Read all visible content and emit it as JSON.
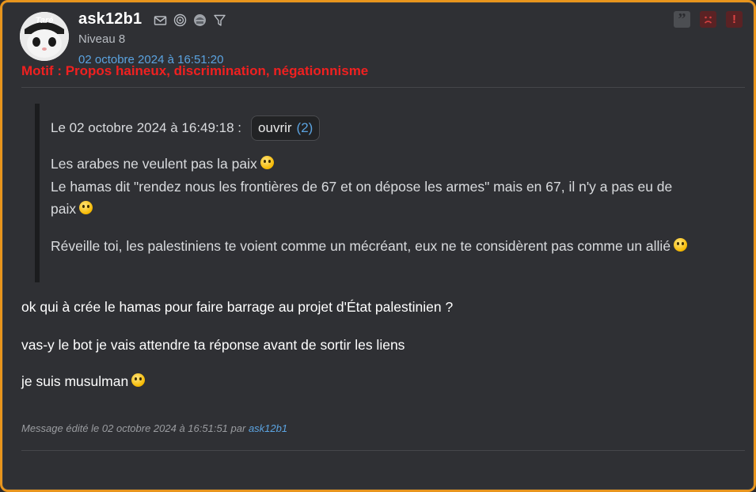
{
  "post": {
    "author": "ask12b1",
    "level": "Niveau 8",
    "date": "02 octobre 2024 à 16:51:20",
    "motif": "Motif : Propos haineux, discrimination, négationnisme",
    "avatar_text": "Taré",
    "icons": [
      "mail-icon",
      "spiral-icon",
      "badge-icon",
      "filter-icon"
    ],
    "actions": [
      "quote-icon",
      "sad-face-icon",
      "alert-icon"
    ]
  },
  "quote": {
    "header": "Le 02 octobre 2024 à 16:49:18 :",
    "open_label": "ouvrir",
    "open_count": "(2)",
    "line1": "Les arabes ne veulent pas la paix",
    "line2": "Le hamas dit \"rendez nous les frontières de 67 et on dépose les armes\" mais en 67, il n'y a pas eu de",
    "line3": "paix",
    "line4": "Réveille toi, les palestiniens te voient comme un mécréant, eux ne te considèrent pas comme un allié"
  },
  "message": {
    "p1": "ok qui à crée le hamas pour faire barrage au projet d'État palestinien ?",
    "p2": "vas-y le bot je vais attendre ta réponse avant de sortir les liens",
    "p3": "je suis musulman"
  },
  "edit": {
    "prefix": "Message édité le 02 octobre 2024 à 16:51:51 par",
    "user": "ask12b1"
  },
  "colors": {
    "border": "#e8951d",
    "background": "#2f3034",
    "link": "#5ba3e0",
    "motif": "#f02020"
  }
}
